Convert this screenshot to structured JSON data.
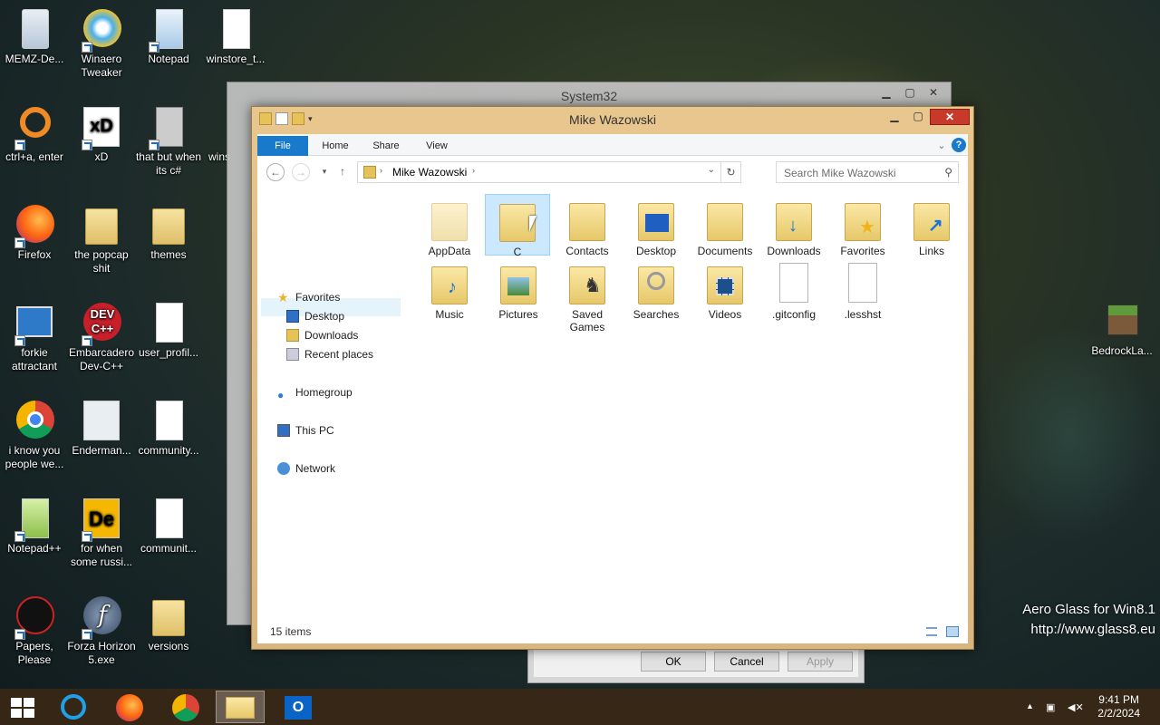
{
  "desktop": {
    "icons": [
      {
        "label": "MEMZ-De..."
      },
      {
        "label": "Winaero Tweaker"
      },
      {
        "label": "Notepad"
      },
      {
        "label": "winstore_t..."
      },
      {
        "label": "ctrl+a, enter"
      },
      {
        "label": "xD"
      },
      {
        "label": "that but when its c#"
      },
      {
        "label": "wins"
      },
      {
        "label": "Firefox"
      },
      {
        "label": "the popcap shit"
      },
      {
        "label": "themes"
      },
      {
        "label": "forkie attractant"
      },
      {
        "label": "Embarcadero Dev-C++"
      },
      {
        "label": "user_profil..."
      },
      {
        "label": "i know you people we..."
      },
      {
        "label": "Enderman..."
      },
      {
        "label": "community..."
      },
      {
        "label": "Notepad++"
      },
      {
        "label": "for when some russi..."
      },
      {
        "label": "communit..."
      },
      {
        "label": "Papers, Please"
      },
      {
        "label": "Forza Horizon 5.exe"
      },
      {
        "label": "versions"
      },
      {
        "label": "BedrockLa..."
      }
    ],
    "xd_text": "xD",
    "dev_text": "DEV C++",
    "de_text": "De"
  },
  "bg_window": {
    "title": "System32"
  },
  "dialog": {
    "ok": "OK",
    "cancel": "Cancel",
    "apply": "Apply"
  },
  "window": {
    "title": "Mike Wazowski",
    "tabs": [
      "File",
      "Home",
      "Share",
      "View"
    ],
    "address": "Mike Wazowski",
    "search_placeholder": "Search Mike Wazowski",
    "nav": {
      "favorites": "Favorites",
      "desktop": "Desktop",
      "downloads": "Downloads",
      "recent": "Recent places",
      "homegroup": "Homegroup",
      "thispc": "This PC",
      "network": "Network"
    },
    "items": [
      {
        "label": "AppData",
        "type": "folder"
      },
      {
        "label": "C",
        "type": "folder"
      },
      {
        "label": "Contacts",
        "type": "folder"
      },
      {
        "label": "Desktop",
        "type": "folder"
      },
      {
        "label": "Documents",
        "type": "folder"
      },
      {
        "label": "Downloads",
        "type": "folder"
      },
      {
        "label": "Favorites",
        "type": "folder"
      },
      {
        "label": "Links",
        "type": "folder"
      },
      {
        "label": "Music",
        "type": "folder"
      },
      {
        "label": "Pictures",
        "type": "folder"
      },
      {
        "label": "Saved Games",
        "type": "folder"
      },
      {
        "label": "Searches",
        "type": "folder"
      },
      {
        "label": "Videos",
        "type": "folder"
      },
      {
        "label": ".gitconfig",
        "type": "file"
      },
      {
        "label": ".lesshst",
        "type": "file"
      }
    ],
    "status": "15 items"
  },
  "watermark": {
    "line1": "Aero Glass for Win8.1",
    "line2": "http://www.glass8.eu"
  },
  "taskbar": {
    "time": "9:41 PM",
    "date": "2/2/2024",
    "outlook_letter": "O"
  }
}
